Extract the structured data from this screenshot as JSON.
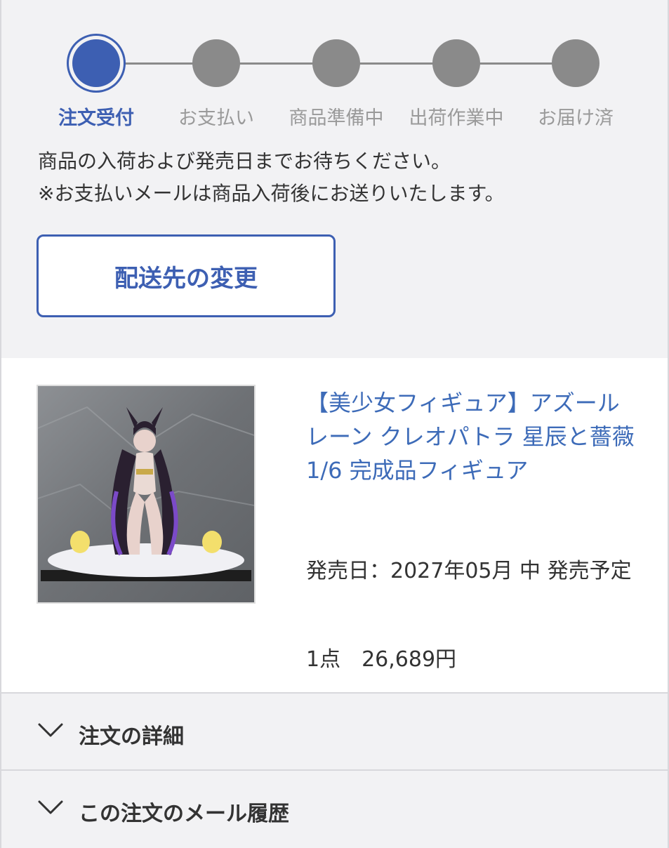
{
  "stepper": {
    "steps": [
      {
        "label": "注文受付",
        "active": true
      },
      {
        "label": "お支払い",
        "active": false
      },
      {
        "label": "商品準備中",
        "active": false
      },
      {
        "label": "出荷作業中",
        "active": false
      },
      {
        "label": "お届け済",
        "active": false
      }
    ],
    "active_color": "#3d5fb2",
    "inactive_color": "#8a8a8a"
  },
  "message": {
    "line1": "商品の入荷および発売日までお待ちください。",
    "line2": "※お支払いメールは商品入荷後にお送りいたします。"
  },
  "address_button": {
    "label": "配送先の変更"
  },
  "product": {
    "title": "【美少女フィギュア】アズールレーン クレオパトラ 星辰と薔薇 1/6 完成品フィギュア",
    "release_date": "発売日：2027年05月 中 発売予定",
    "quantity_price": "1点　26,689円",
    "image_icon": "figure-photo"
  },
  "accordions": [
    {
      "label": "注文の詳細",
      "icon": "chevron-down-icon"
    },
    {
      "label": "この注文のメール履歴",
      "icon": "chevron-down-icon"
    }
  ]
}
